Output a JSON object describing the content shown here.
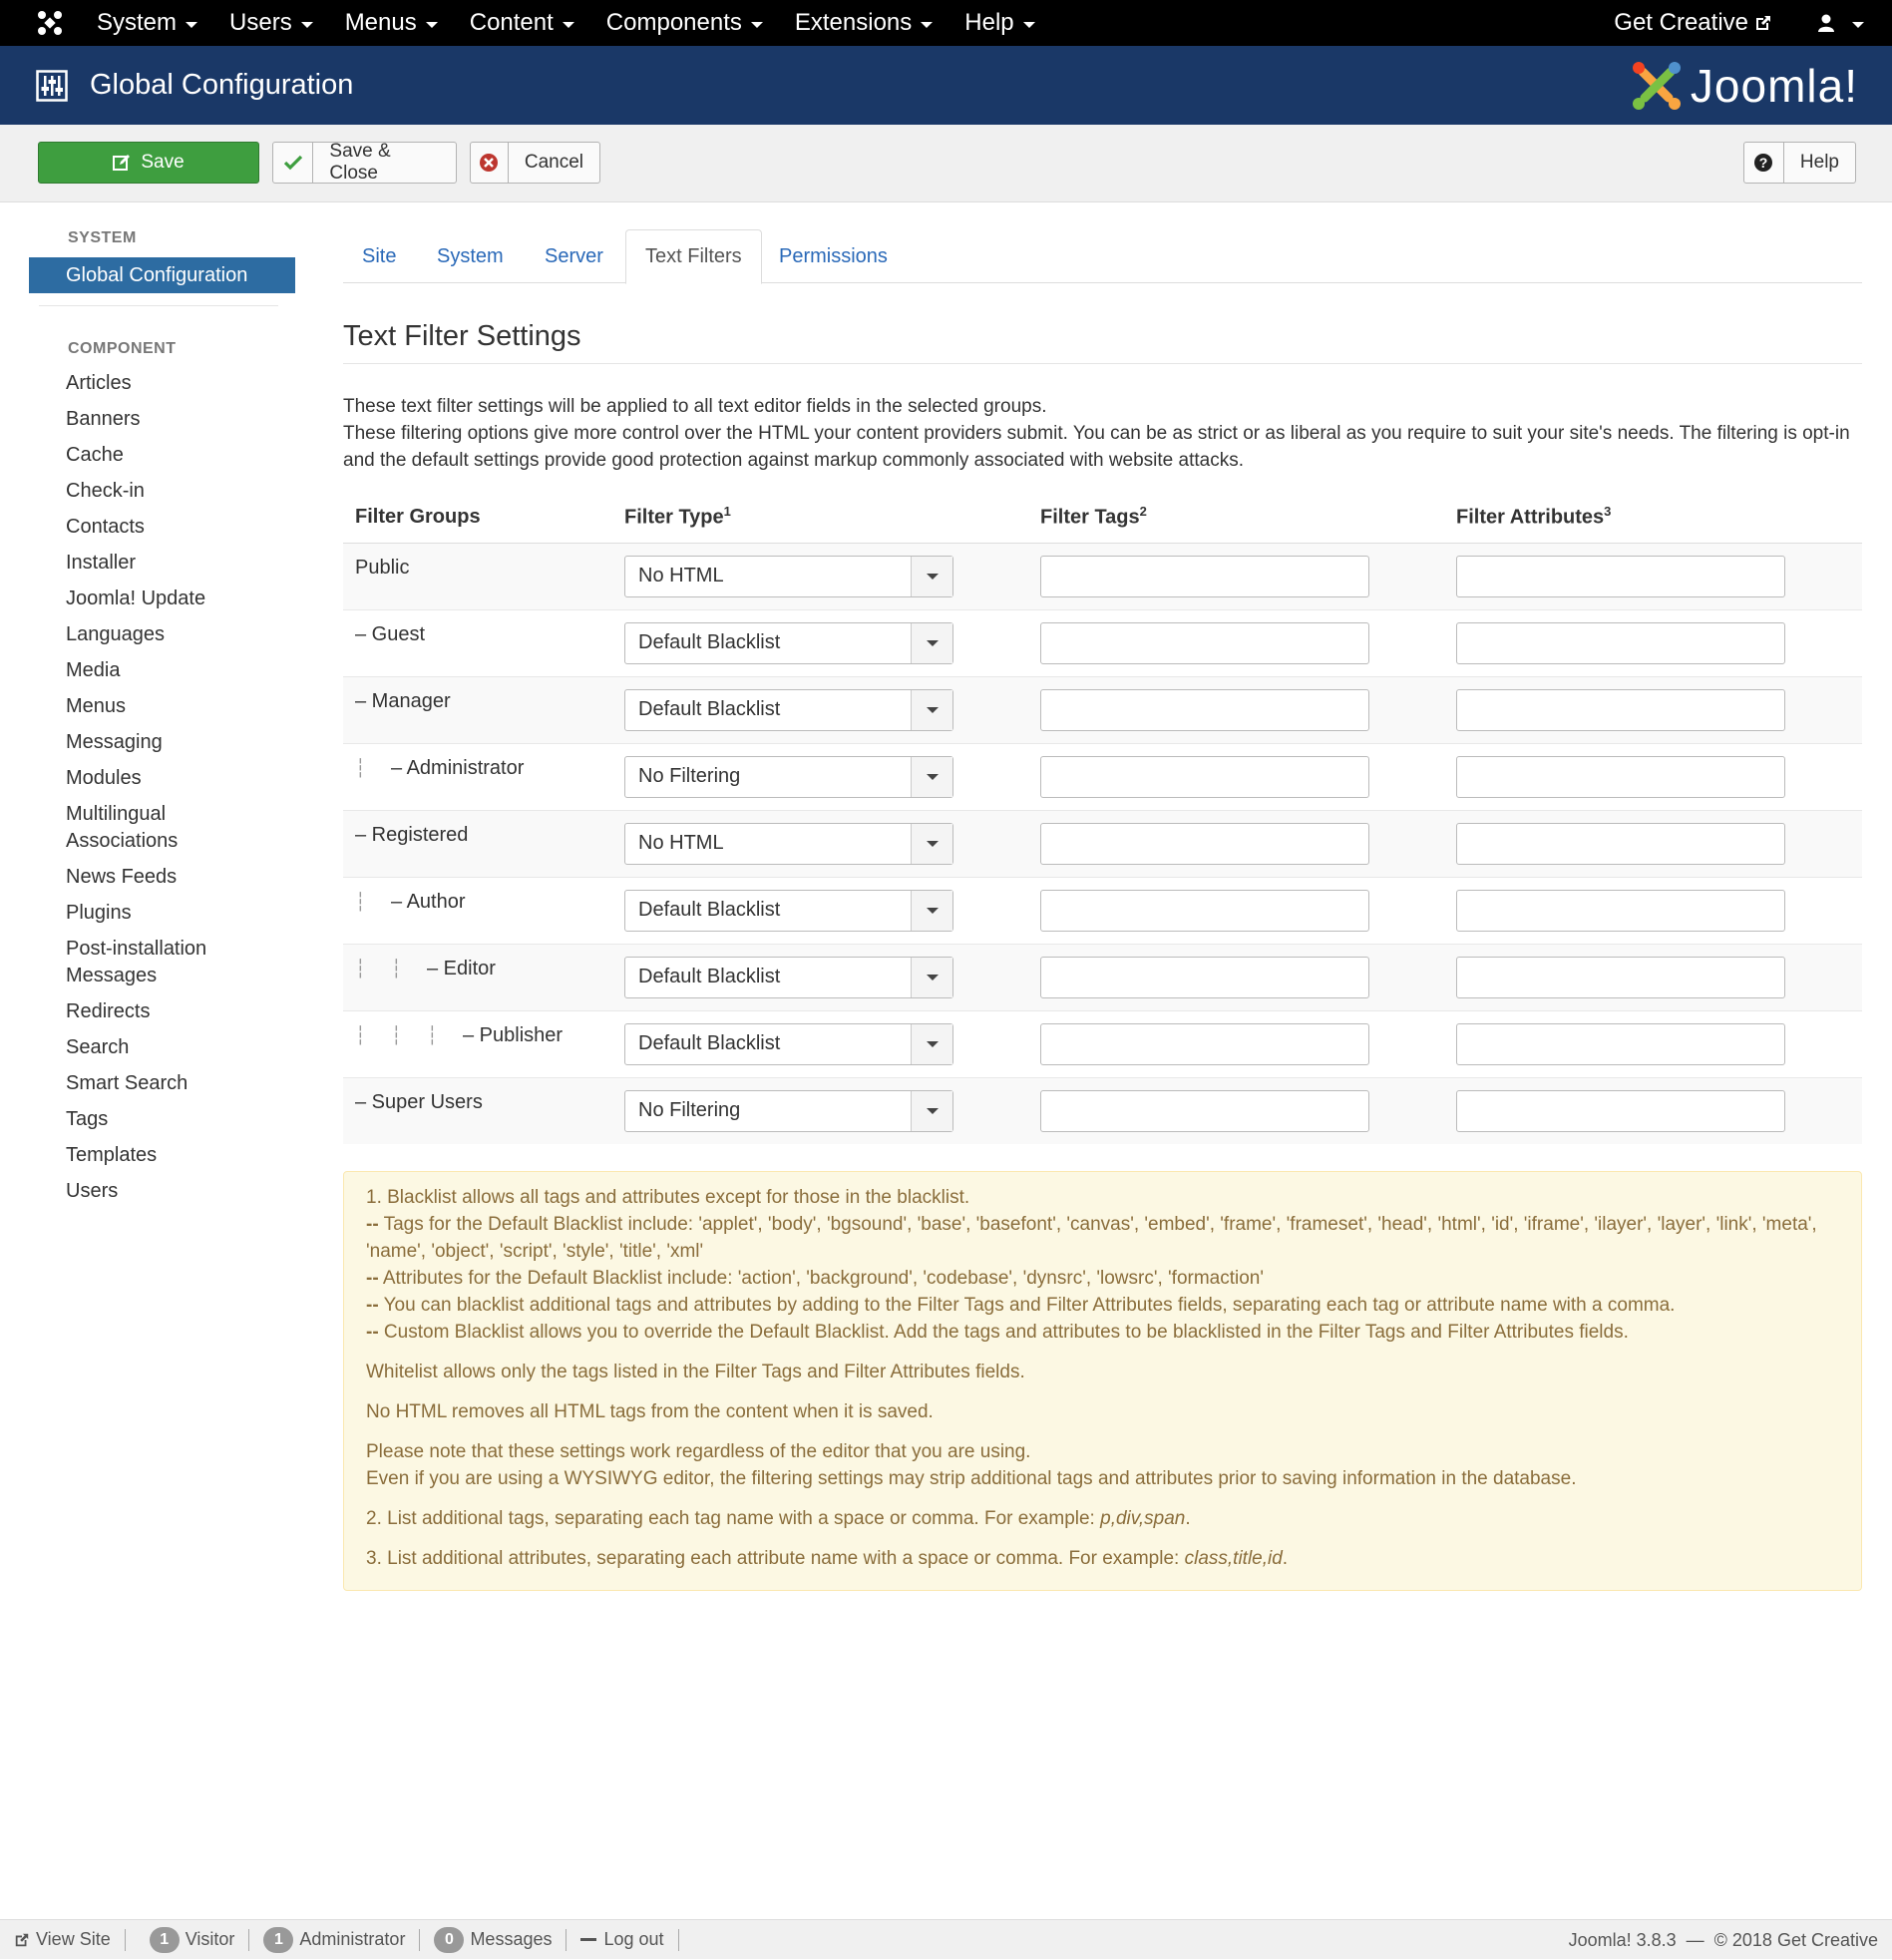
{
  "topnav": {
    "menu": [
      "System",
      "Users",
      "Menus",
      "Content",
      "Components",
      "Extensions",
      "Help"
    ],
    "get_creative": "Get Creative"
  },
  "header": {
    "title": "Global Configuration",
    "brand": "Joomla!"
  },
  "toolbar": {
    "save": "Save",
    "save_close": "Save & Close",
    "cancel": "Cancel",
    "help": "Help"
  },
  "sidebar": {
    "system_heading": "SYSTEM",
    "active_item": "Global Configuration",
    "component_heading": "COMPONENT",
    "items": [
      "Articles",
      "Banners",
      "Cache",
      "Check-in",
      "Contacts",
      "Installer",
      "Joomla! Update",
      "Languages",
      "Media",
      "Menus",
      "Messaging",
      "Modules",
      "Multilingual Associations",
      "News Feeds",
      "Plugins",
      "Post-installation Messages",
      "Redirects",
      "Search",
      "Smart Search",
      "Tags",
      "Templates",
      "Users"
    ]
  },
  "tabs": [
    "Site",
    "System",
    "Server",
    "Text Filters",
    "Permissions"
  ],
  "active_tab": "Text Filters",
  "section": {
    "title": "Text Filter Settings",
    "desc_line1": "These text filter settings will be applied to all text editor fields in the selected groups.",
    "desc_line2": "These filtering options give more control over the HTML your content providers submit. You can be as strict or as liberal as you require to suit your site's needs. The filtering is opt-in and the default settings provide good protection against markup commonly associated with website attacks."
  },
  "table": {
    "headers": {
      "groups": "Filter Groups",
      "type": "Filter Type",
      "type_sup": "1",
      "tags": "Filter Tags",
      "tags_sup": "2",
      "attrs": "Filter Attributes",
      "attrs_sup": "3"
    },
    "rows": [
      {
        "group": "Public",
        "depth": 0,
        "type": "No HTML",
        "tags": "",
        "attrs": ""
      },
      {
        "group": "– Guest",
        "depth": 0,
        "type": "Default Blacklist",
        "tags": "",
        "attrs": ""
      },
      {
        "group": "– Manager",
        "depth": 0,
        "type": "Default Blacklist",
        "tags": "",
        "attrs": ""
      },
      {
        "group": "– Administrator",
        "depth": 1,
        "type": "No Filtering",
        "tags": "",
        "attrs": ""
      },
      {
        "group": "– Registered",
        "depth": 0,
        "type": "No HTML",
        "tags": "",
        "attrs": ""
      },
      {
        "group": "– Author",
        "depth": 1,
        "type": "Default Blacklist",
        "tags": "",
        "attrs": ""
      },
      {
        "group": "– Editor",
        "depth": 2,
        "type": "Default Blacklist",
        "tags": "",
        "attrs": ""
      },
      {
        "group": "– Publisher",
        "depth": 3,
        "type": "Default Blacklist",
        "tags": "",
        "attrs": ""
      },
      {
        "group": "– Super Users",
        "depth": 0,
        "type": "No Filtering",
        "tags": "",
        "attrs": ""
      }
    ]
  },
  "notes": {
    "n1": "1. Blacklist allows all tags and attributes except for those in the blacklist.",
    "n1a_prefix": "--",
    "n1a": " Tags for the Default Blacklist include: 'applet', 'body', 'bgsound', 'base', 'basefont', 'canvas', 'embed', 'frame', 'frameset', 'head', 'html', 'id', 'iframe', 'ilayer', 'layer', 'link', 'meta', 'name', 'object', 'script', 'style', 'title', 'xml'",
    "n1b": " Attributes for the Default Blacklist include: 'action', 'background', 'codebase', 'dynsrc', 'lowsrc', 'formaction'",
    "n1c": " You can blacklist additional tags and attributes by adding to the Filter Tags and Filter Attributes fields, separating each tag or attribute name with a comma.",
    "n1d": " Custom Blacklist allows you to override the Default Blacklist. Add the tags and attributes to be blacklisted in the Filter Tags and Filter Attributes fields.",
    "whitelist": "Whitelist allows only the tags listed in the Filter Tags and Filter Attributes fields.",
    "nohtml": "No HTML removes all HTML tags from the content when it is saved.",
    "note_a": "Please note that these settings work regardless of the editor that you are using.",
    "note_b": "Even if you are using a WYSIWYG editor, the filtering settings may strip additional tags and attributes prior to saving information in the database.",
    "n2": "2. List additional tags, separating each tag name with a space or comma. For example: ",
    "n2_example": "p,div,span",
    "n3": "3. List additional attributes, separating each attribute name with a space or comma. For example: ",
    "n3_example": "class,title,id",
    "period": "."
  },
  "statusbar": {
    "view_site": "View Site",
    "visitor_count": "1",
    "visitor": "Visitor",
    "admin_count": "1",
    "admin": "Administrator",
    "messages_count": "0",
    "messages": "Messages",
    "logout": "Log out",
    "version": "Joomla! 3.8.3",
    "dash": "—",
    "copyright": "© 2018 Get Creative"
  }
}
